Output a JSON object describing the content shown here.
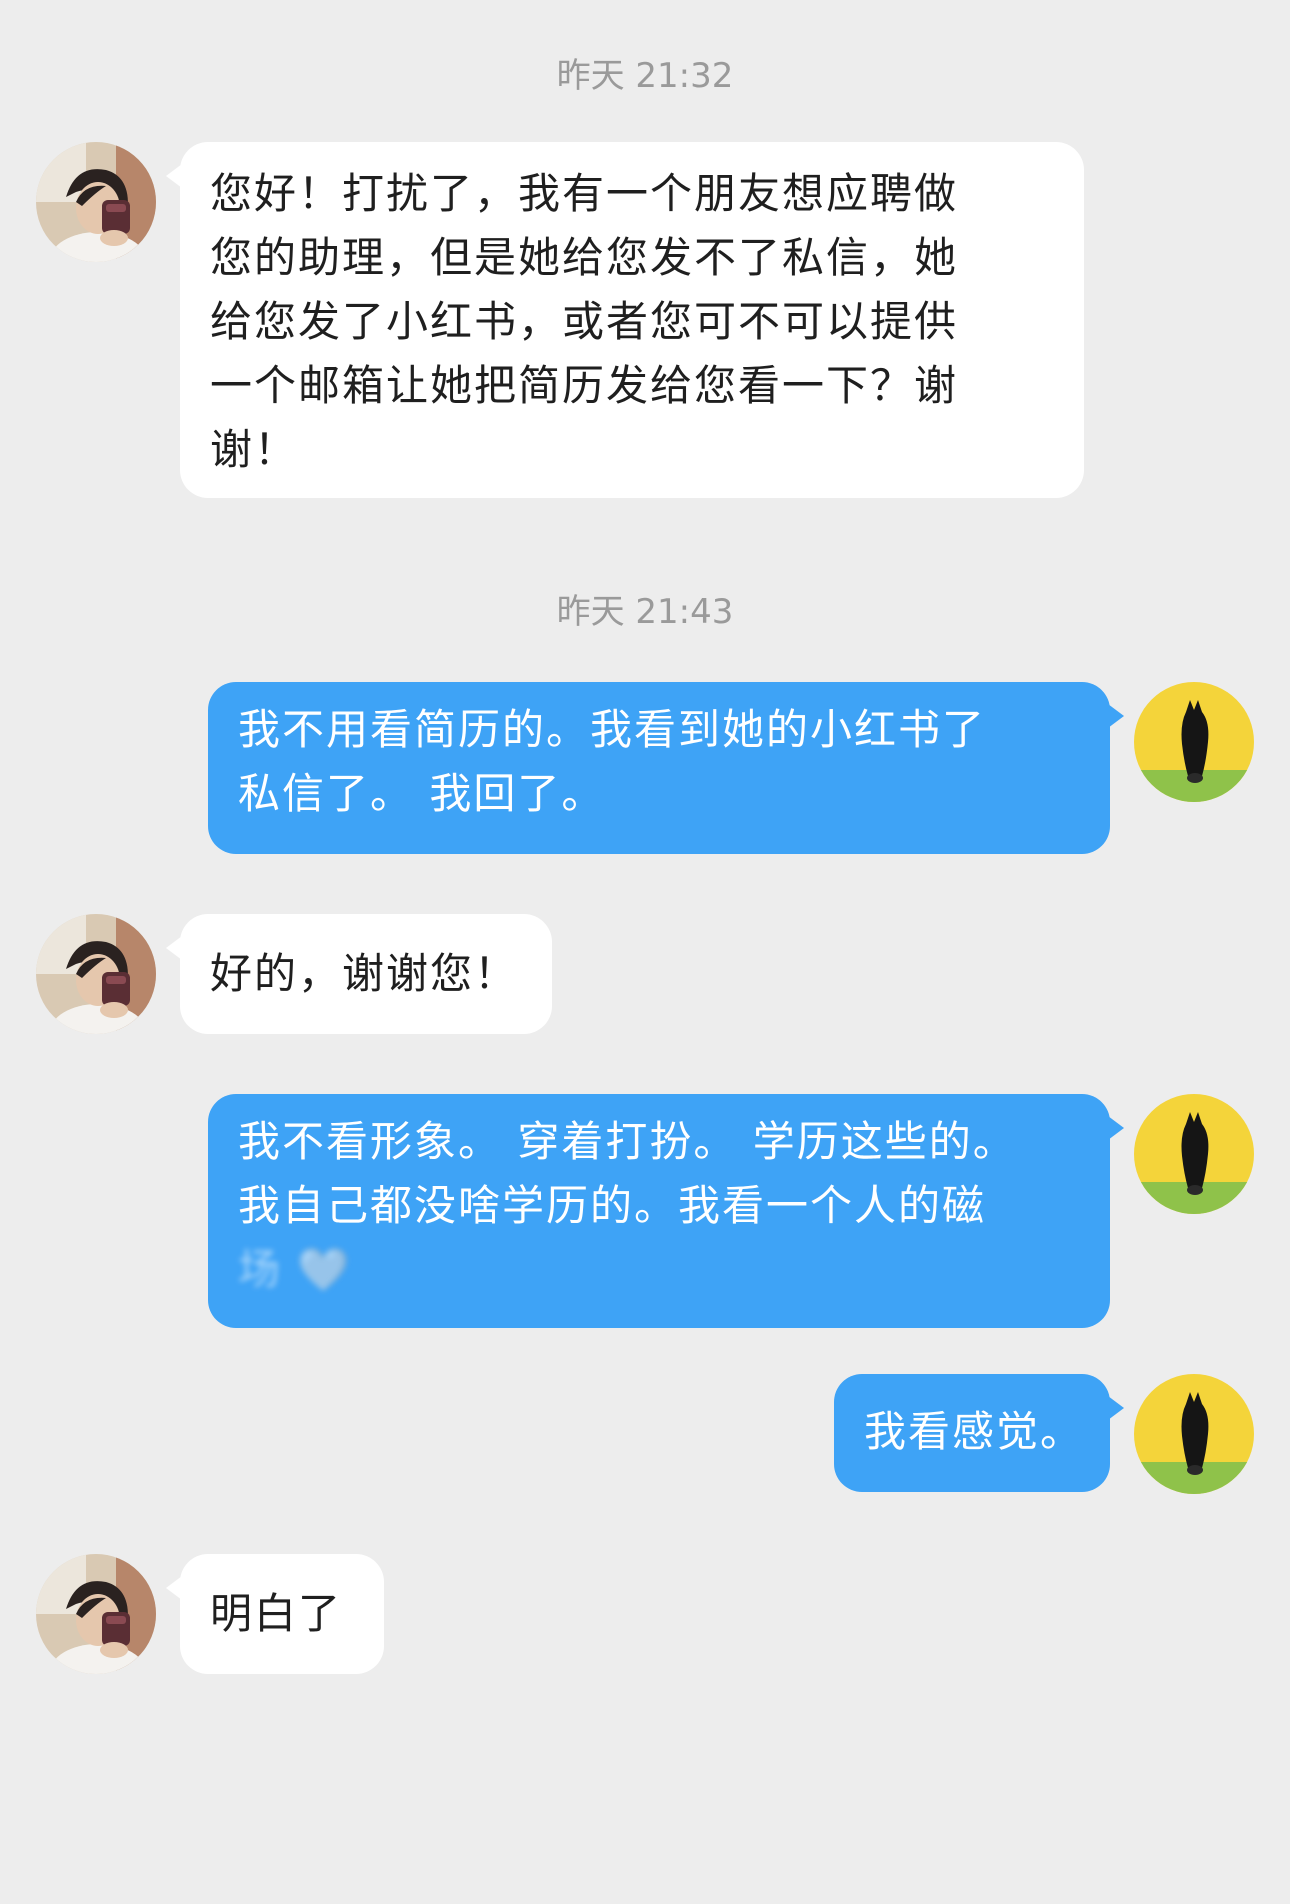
{
  "timestamps": [
    "昨天 21:32",
    "昨天 21:43"
  ],
  "icons": {
    "incoming_avatar": "person-photo-avatar-icon",
    "outgoing_avatar": "horse-head-avatar-icon"
  },
  "colors": {
    "background": "#ededed",
    "incoming_bubble": "#ffffff",
    "outgoing_bubble": "#3ea3f6",
    "timestamp_text": "#9a9a9a"
  },
  "messages": [
    {
      "direction": "incoming",
      "lines": [
        "您好！打扰了，我有一个朋友想应聘做",
        "您的助理，但是她给您发不了私信，她",
        "给您发了小红书，或者您可不可以提供",
        "一个邮箱让她把简历发给您看一下？谢",
        "谢！"
      ]
    },
    {
      "direction": "outgoing",
      "lines": [
        "我不用看简历的。我看到她的小红书了",
        "私信了。 我回了。"
      ]
    },
    {
      "direction": "incoming",
      "lines": [
        "好的，谢谢您！"
      ]
    },
    {
      "direction": "outgoing",
      "lines": [
        "我不看形象。 穿着打扮。 学历这些的。",
        "我自己都没啥学历的。我看一个人的磁"
      ],
      "faded_line": "场 🤍"
    },
    {
      "direction": "outgoing",
      "lines": [
        "我看感觉。"
      ]
    },
    {
      "direction": "incoming",
      "lines": [
        "明白了"
      ]
    }
  ]
}
